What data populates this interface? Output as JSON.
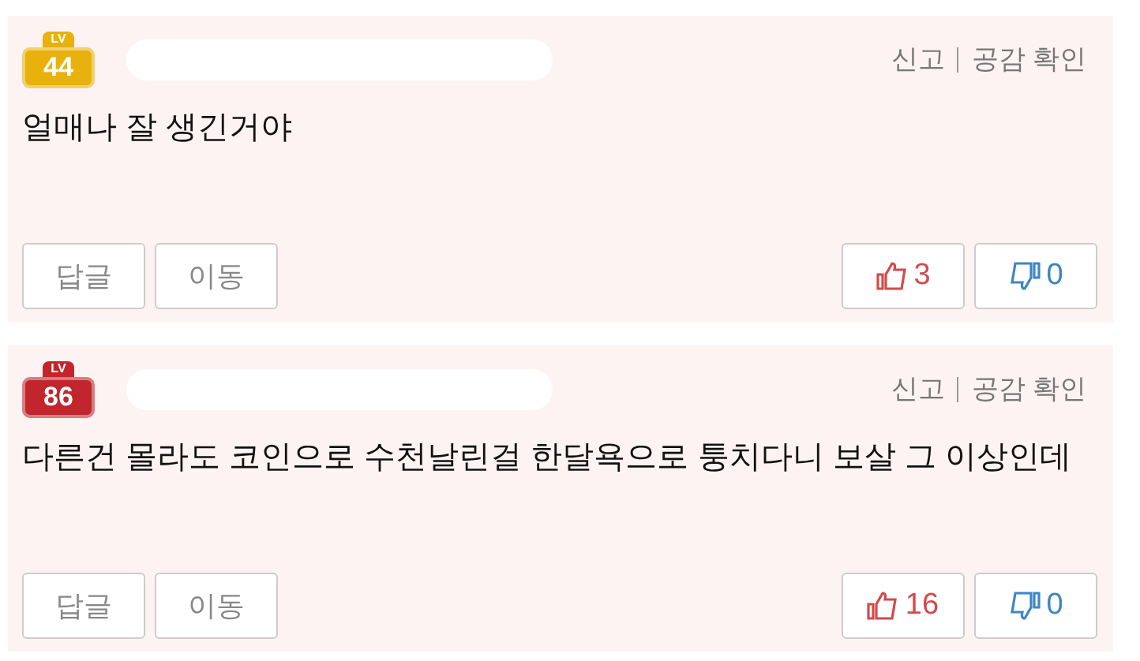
{
  "comments": [
    {
      "badge": {
        "label": "LV",
        "level": "44",
        "color": "#e8b10e"
      },
      "actions": [
        "신고",
        "공감 확인"
      ],
      "text": "얼매나 잘 생긴거야",
      "buttons": [
        "답글",
        "이동"
      ],
      "likes": "3",
      "dislikes": "0"
    },
    {
      "badge": {
        "label": "LV",
        "level": "86",
        "color": "#c0262c"
      },
      "actions": [
        "신고",
        "공감 확인"
      ],
      "text": "다른건 몰라도 코인으로 수천날린걸 한달욕으로 퉁치다니 보살 그 이상인데",
      "buttons": [
        "답글",
        "이동"
      ],
      "likes": "16",
      "dislikes": "0"
    }
  ]
}
